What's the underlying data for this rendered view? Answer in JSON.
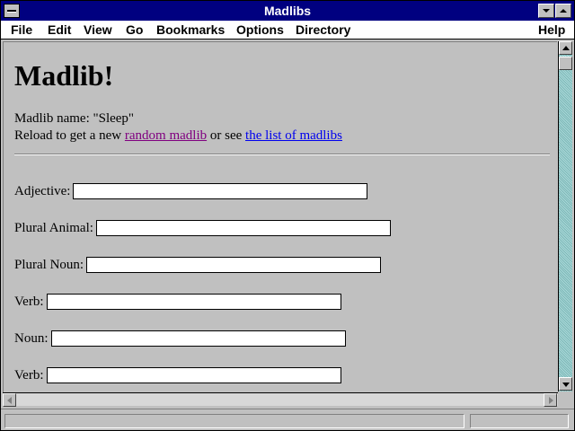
{
  "window": {
    "title": "Madlibs"
  },
  "menu": {
    "items": [
      "File",
      "Edit",
      "View",
      "Go",
      "Bookmarks",
      "Options",
      "Directory"
    ],
    "help": "Help"
  },
  "page": {
    "heading": "Madlib!",
    "name_line": "Madlib name: \"Sleep\"",
    "reload_prefix": "Reload to get a new ",
    "random_link": "random madlib",
    "middle_text": " or see ",
    "list_link": "the list of madlibs",
    "fields": [
      {
        "label": "Adjective:",
        "value": ""
      },
      {
        "label": "Plural Animal:",
        "value": ""
      },
      {
        "label": "Plural Noun:",
        "value": ""
      },
      {
        "label": "Verb:",
        "value": ""
      },
      {
        "label": "Noun:",
        "value": ""
      },
      {
        "label": "Verb:",
        "value": ""
      }
    ]
  },
  "icons": {
    "system_menu": "system-menu-icon",
    "minimize": "minimize-arrow-icon",
    "maximize": "maximize-arrow-icon",
    "scroll_up": "up-arrow-icon",
    "scroll_down": "down-arrow-icon",
    "scroll_left": "left-arrow-icon",
    "scroll_right": "right-arrow-icon"
  },
  "colors": {
    "titlebar": "#000080",
    "background": "#c0c0c0",
    "visited_link": "#800080",
    "unvisited_link": "#0000ee",
    "scrollbar_track": "#80c0c0"
  },
  "status": {
    "text": ""
  }
}
